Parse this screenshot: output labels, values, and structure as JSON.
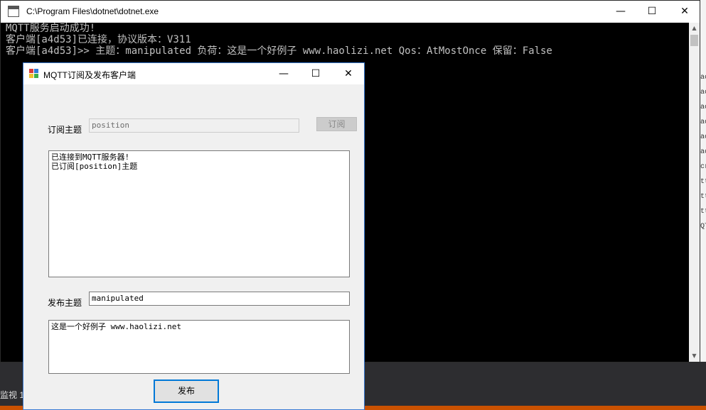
{
  "console": {
    "title": "C:\\Program Files\\dotnet\\dotnet.exe",
    "minimize_glyph": "—",
    "maximize_glyph": "☐",
    "close_glyph": "✕",
    "lines": [
      "MQTT服务启动成功!",
      "客户端[a4d53]已连接，协议版本：V311",
      "客户端[a4d53]>> 主题：manipulated 负荷：这是一个好例子 www.haolizi.net Qos：AtMostOnce 保留：False"
    ]
  },
  "dialog": {
    "title": "MQTT订阅及发布客户端",
    "minimize_glyph": "—",
    "maximize_glyph": "☐",
    "close_glyph": "✕",
    "subscribe": {
      "label": "订阅主题",
      "topic_value": "position",
      "button_label": "订阅"
    },
    "log_lines": "已连接到MQTT服务器!\n已订阅[position]主题",
    "publish": {
      "label": "发布主题",
      "topic_value": "manipulated",
      "message_value": "这是一个好例子 www.haolizi.net",
      "button_label": "发布"
    }
  },
  "background": {
    "bottom_label": "监视 1",
    "right_fragments": [
      "ac",
      "ac",
      "ac",
      "ac",
      "ac",
      "ac",
      "cr",
      "tt",
      "tt",
      "tt",
      "QT"
    ]
  },
  "colors": {
    "accent": "#0078d7",
    "console_bg": "#000000",
    "console_text": "#c0c0c0",
    "status_bar": "#ca5100"
  }
}
